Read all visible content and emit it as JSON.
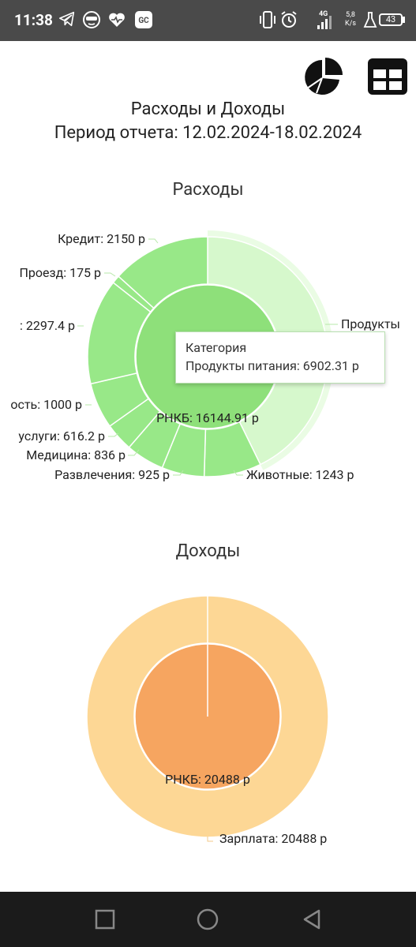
{
  "status_bar": {
    "time": "11:38",
    "network_speed_value": "5,8",
    "network_speed_unit": "K/s",
    "network_type": "4G",
    "battery": "43",
    "left_icons": [
      "telegram-icon",
      "vpn-icon",
      "health-heart-icon",
      "gc-app-icon"
    ],
    "right_icons": [
      "vibrate-icon",
      "alarm-icon",
      "signal-icon",
      "flask-icon",
      "battery-icon"
    ]
  },
  "toolbar": {
    "pie_chart_icon": "pie-chart-icon",
    "table_view_icon": "table-view-icon"
  },
  "header": {
    "title": "Расходы и Доходы",
    "period": "Период отчета: 12.02.2024-18.02.2024"
  },
  "expenses_chart": {
    "title": "Расходы",
    "inner_label": "РНКБ: 16144.91 р",
    "labels": {
      "credit": "Кредит: 2150 р",
      "travel": "Проезд: 175 р",
      "cafe": ": 2297.4 р",
      "communal": "ость: 1000 р",
      "services": "услуги: 616.2 р",
      "medicine": "Медицина: 836 р",
      "entertainment": "Развлечения: 925 р",
      "animals": "Животные: 1243 р",
      "products": "Продукты"
    },
    "tooltip": {
      "header": "Категория",
      "value": "Продукты питания: 6902.31 р"
    }
  },
  "income_chart": {
    "title": "Доходы",
    "inner_label": "РНКБ: 20488 р",
    "outer_label": "Зарплата: 20488 р"
  },
  "nav_bar": {
    "buttons": [
      "recent-apps-button",
      "home-button",
      "back-button"
    ]
  },
  "colors": {
    "status_bar": "#4a4a4a",
    "expense_outer": "#98e888",
    "expense_inner": "#8ee07a",
    "expense_highlight": "#d6f8cc",
    "income_outer": "#fdd795",
    "income_inner": "#f6a560",
    "nav_bar": "#1b1b1b"
  },
  "chart_data": [
    {
      "type": "pie",
      "title": "Расходы",
      "inner_ring": {
        "categories": [
          "РНКБ"
        ],
        "values": [
          16144.91
        ]
      },
      "outer_ring": {
        "categories": [
          "Продукты питания",
          "Животные",
          "Развлечения",
          "Медицина",
          "услуги",
          "ость",
          ": ",
          "Проезд",
          "Кредит"
        ],
        "values": [
          6902.31,
          1243,
          925,
          836,
          616.2,
          1000,
          2297.4,
          175,
          2150
        ]
      },
      "tooltip": "Продукты питания: 6902.31 р"
    },
    {
      "type": "pie",
      "title": "Доходы",
      "inner_ring": {
        "categories": [
          "РНКБ"
        ],
        "values": [
          20488
        ]
      },
      "outer_ring": {
        "categories": [
          "Зарплата"
        ],
        "values": [
          20488
        ]
      }
    }
  ]
}
